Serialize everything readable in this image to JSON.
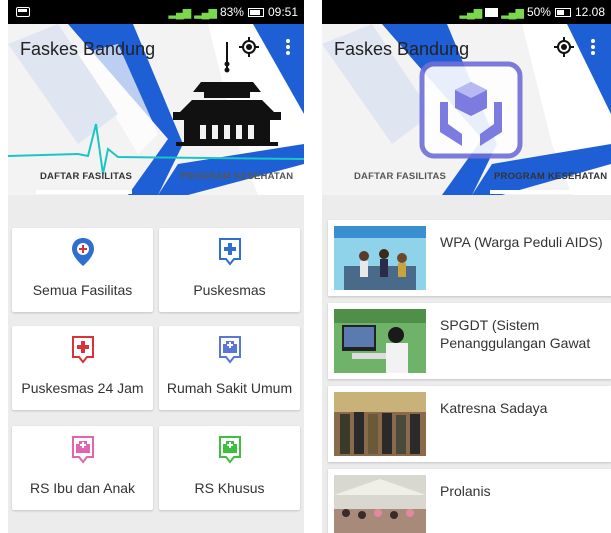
{
  "left_screen": {
    "status": {
      "network": "4G",
      "battery_pct": "83%",
      "time": "09:51"
    },
    "app_title": "Faskes Bandung",
    "tabs": [
      {
        "label": "DAFTAR FASILITAS",
        "active": true
      },
      {
        "label": "PROGRAM KESEHATAN",
        "active": false
      }
    ],
    "tiles": [
      {
        "label": "Semua Fasilitas",
        "icon": "location-pin-icon",
        "color": "#2f6fcf"
      },
      {
        "label": "Puskesmas",
        "icon": "medical-cross-icon",
        "color": "#2f6fcf"
      },
      {
        "label": "Puskesmas 24 Jam",
        "icon": "medical-cross-icon",
        "color": "#d9323a"
      },
      {
        "label": "Rumah Sakit Umum",
        "icon": "hospital-icon",
        "color": "#5a76d6"
      },
      {
        "label": "RS Ibu dan Anak",
        "icon": "hospital-icon",
        "color": "#e065b3"
      },
      {
        "label": "RS Khusus",
        "icon": "hospital-icon",
        "color": "#3fbf3f"
      }
    ]
  },
  "right_screen": {
    "status": {
      "network": "H",
      "battery_pct": "50%",
      "time": "12.08"
    },
    "app_title": "Faskes Bandung",
    "tabs": [
      {
        "label": "DAFTAR FASILITAS",
        "active": false
      },
      {
        "label": "PROGRAM KESEHATAN",
        "active": true
      }
    ],
    "programs": [
      {
        "title": "WPA (Warga Peduli AIDS)",
        "image": "banner-event-photo"
      },
      {
        "title": "SPGDT (Sistem Penanggulangan Gawat",
        "image": "computer-operator-photo"
      },
      {
        "title": "Katresna Sadaya",
        "image": "officials-group-photo"
      },
      {
        "title": "Prolanis",
        "image": "crowd-tent-photo"
      }
    ]
  },
  "colors": {
    "accent_blue": "#1f5fd6",
    "status_bar": "#000000"
  }
}
